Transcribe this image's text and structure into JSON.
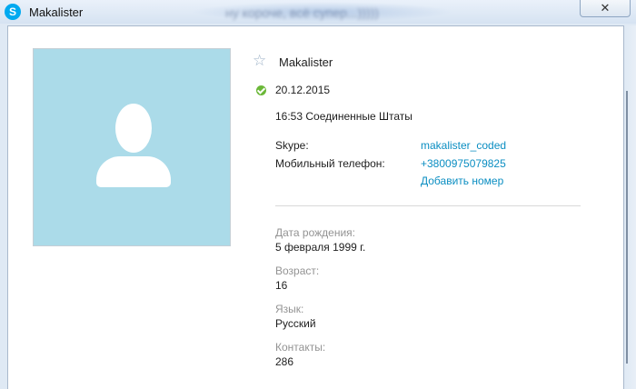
{
  "window": {
    "title": "Makalister",
    "blurred_title": "ну короче, всё супер...)))))",
    "close_glyph": "✕",
    "app_icon_glyph": "S"
  },
  "profile": {
    "name": "Makalister",
    "status_date": "20.12.2015",
    "local_time": "16:53 Соединенные Штаты",
    "skype_label": "Skype:",
    "skype_value": "makalister_coded",
    "mobile_label": "Мобильный телефон:",
    "mobile_value": "+3800975079825",
    "add_number": "Добавить номер"
  },
  "details": {
    "birthday_label": "Дата рождения:",
    "birthday_value": "5 февраля 1999 г.",
    "age_label": "Возраст:",
    "age_value": "16",
    "language_label": "Язык:",
    "language_value": "Русский",
    "contacts_label": "Контакты:",
    "contacts_value": "286"
  },
  "icons": {
    "star": "☆",
    "status": "online-check-icon"
  },
  "colors": {
    "link": "#0b8ec2",
    "avatar_bg": "#abdbe9",
    "status_online": "#6bb838",
    "muted": "#939393"
  }
}
